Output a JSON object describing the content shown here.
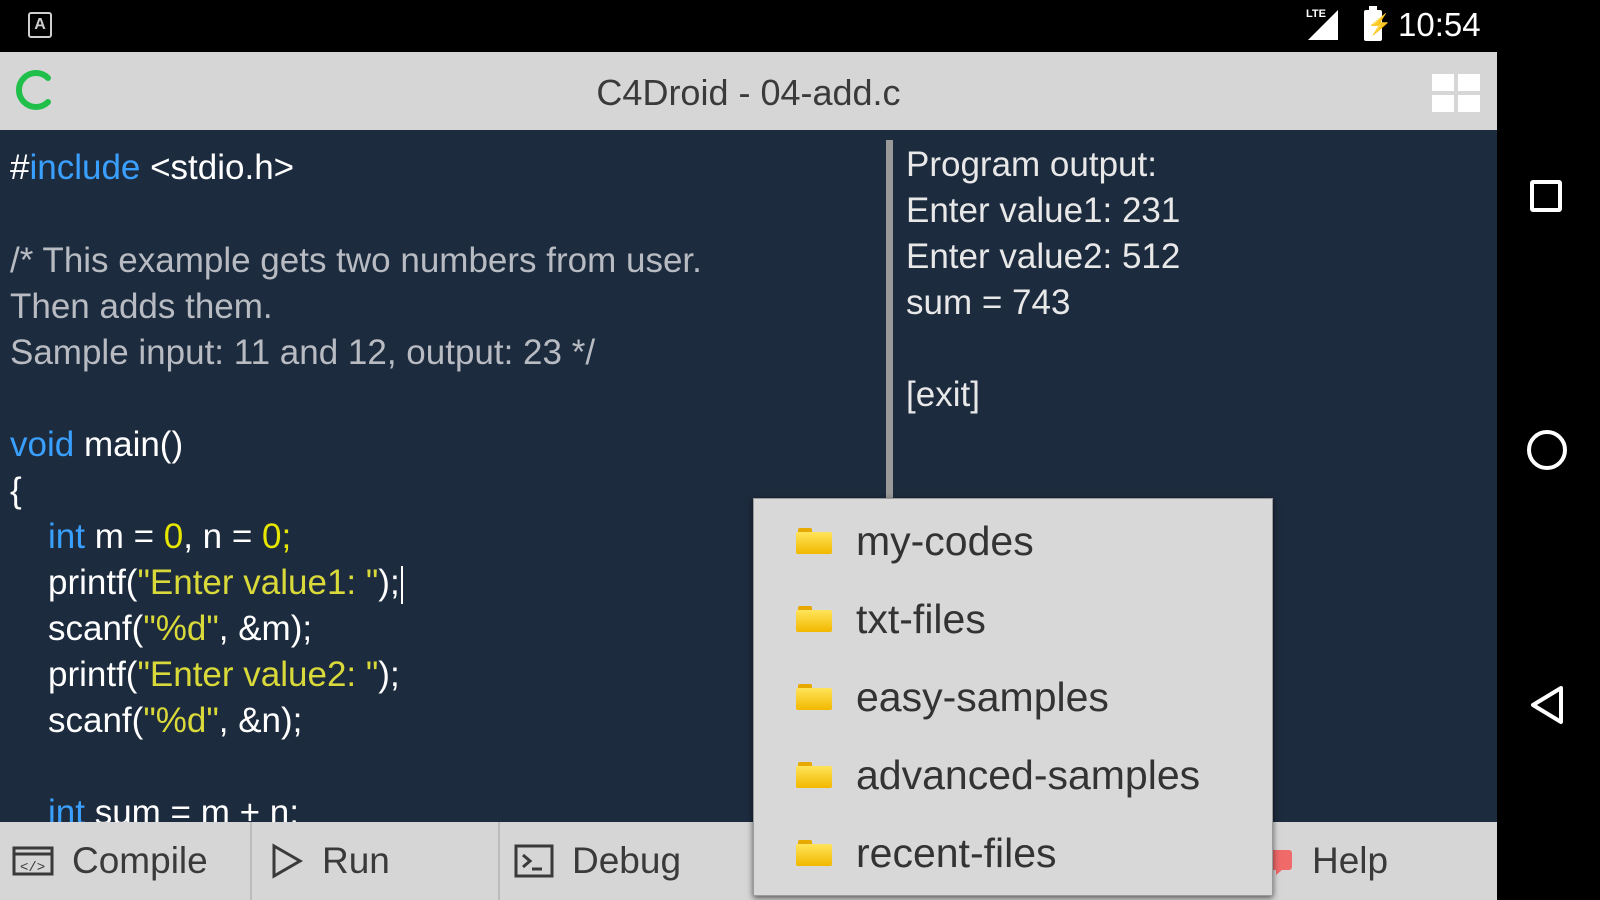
{
  "status_bar": {
    "time": "10:54",
    "left_icon": "A",
    "signal_label": "LTE"
  },
  "title_bar": {
    "title": "C4Droid - 04-add.c",
    "logo_icon": "c4droid-logo-icon",
    "menu_icon": "grid-icon"
  },
  "editor": {
    "lines": [
      "#include <stdio.h>",
      "",
      "/* This example gets two numbers from user.",
      "Then adds them.",
      "Sample input: 11 and 12, output: 23 */",
      "",
      "void main()",
      "{",
      "    int m = 0, n = 0;",
      "    printf(\"Enter value1: \");",
      "    scanf(\"%d\", &m);",
      "    printf(\"Enter value2: \");",
      "    scanf(\"%d\", &n);",
      "",
      "    int sum = m + n;"
    ],
    "tokens": {
      "l0_hash": "#",
      "l0_kw": "include",
      "l0_rest": " <stdio.h>",
      "l2": "/* This example gets two numbers from user.",
      "l3": "Then adds them.",
      "l4": "Sample input: 11 and 12, output: 23 */",
      "l6_kw": "void",
      "l6_rest": " main()",
      "l7": "{",
      "l8_kw": "int",
      "l8_a": " m = ",
      "l8_n1": "0",
      "l8_b": ", n = ",
      "l8_n2": "0",
      "l8_c": ";",
      "l9_a": "printf(",
      "l9_s": "\"Enter value1: \"",
      "l9_b": ");",
      "l10_a": "scanf(",
      "l10_s": "\"%d\"",
      "l10_b": ", &m);",
      "l11_a": "printf(",
      "l11_s": "\"Enter value2: \"",
      "l11_b": ");",
      "l12_a": "scanf(",
      "l12_s": "\"%d\"",
      "l12_b": ", &n);",
      "l14_kw": "int",
      "l14_rest": " sum = m + n;"
    }
  },
  "output": {
    "lines": [
      "Program output:",
      "Enter value1: 231",
      "Enter value2: 512",
      "sum = 743",
      "",
      "[exit]"
    ]
  },
  "toolbar": {
    "compile": "Compile",
    "run": "Run",
    "debug": "Debug",
    "help": "Help"
  },
  "menu": {
    "items": [
      "my-codes",
      "txt-files",
      "easy-samples",
      "advanced-samples",
      "recent-files"
    ]
  },
  "colors": {
    "editor_bg": "#1d2b3e",
    "keyword": "#3aa0ff",
    "comment": "#b8bcc2",
    "string": "#d9d93a",
    "bars": "#d6d6d6",
    "logo": "#1fbf4a"
  }
}
